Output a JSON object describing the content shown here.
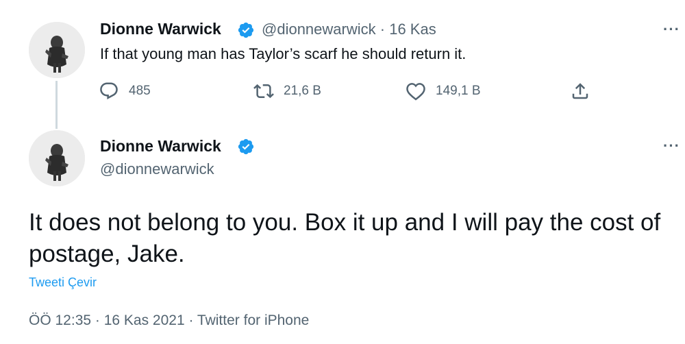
{
  "tweet1": {
    "author_name": "Dionne Warwick",
    "handle": "@dionnewarwick",
    "separator": "·",
    "date": "16 Kas",
    "text": "If that young man has Taylor’s scarf he should return it.",
    "replies": "485",
    "retweets": "21,6 B",
    "likes": "149,1 B",
    "more_label": "···"
  },
  "tweet2": {
    "author_name": "Dionne Warwick",
    "handle": "@dionnewarwick",
    "text": "It does not belong to you. Box it up and I will pay the cost of postage, Jake.",
    "translate_label": "Tweeti Çevir",
    "meta": "ÖÖ 12:35 · 16 Kas 2021 · Twitter for iPhone",
    "more_label": "···"
  },
  "icons": {
    "verified_color": "#1d9bf0",
    "reply": "reply-icon",
    "retweet": "retweet-icon",
    "like": "heart-icon",
    "share": "share-icon"
  }
}
